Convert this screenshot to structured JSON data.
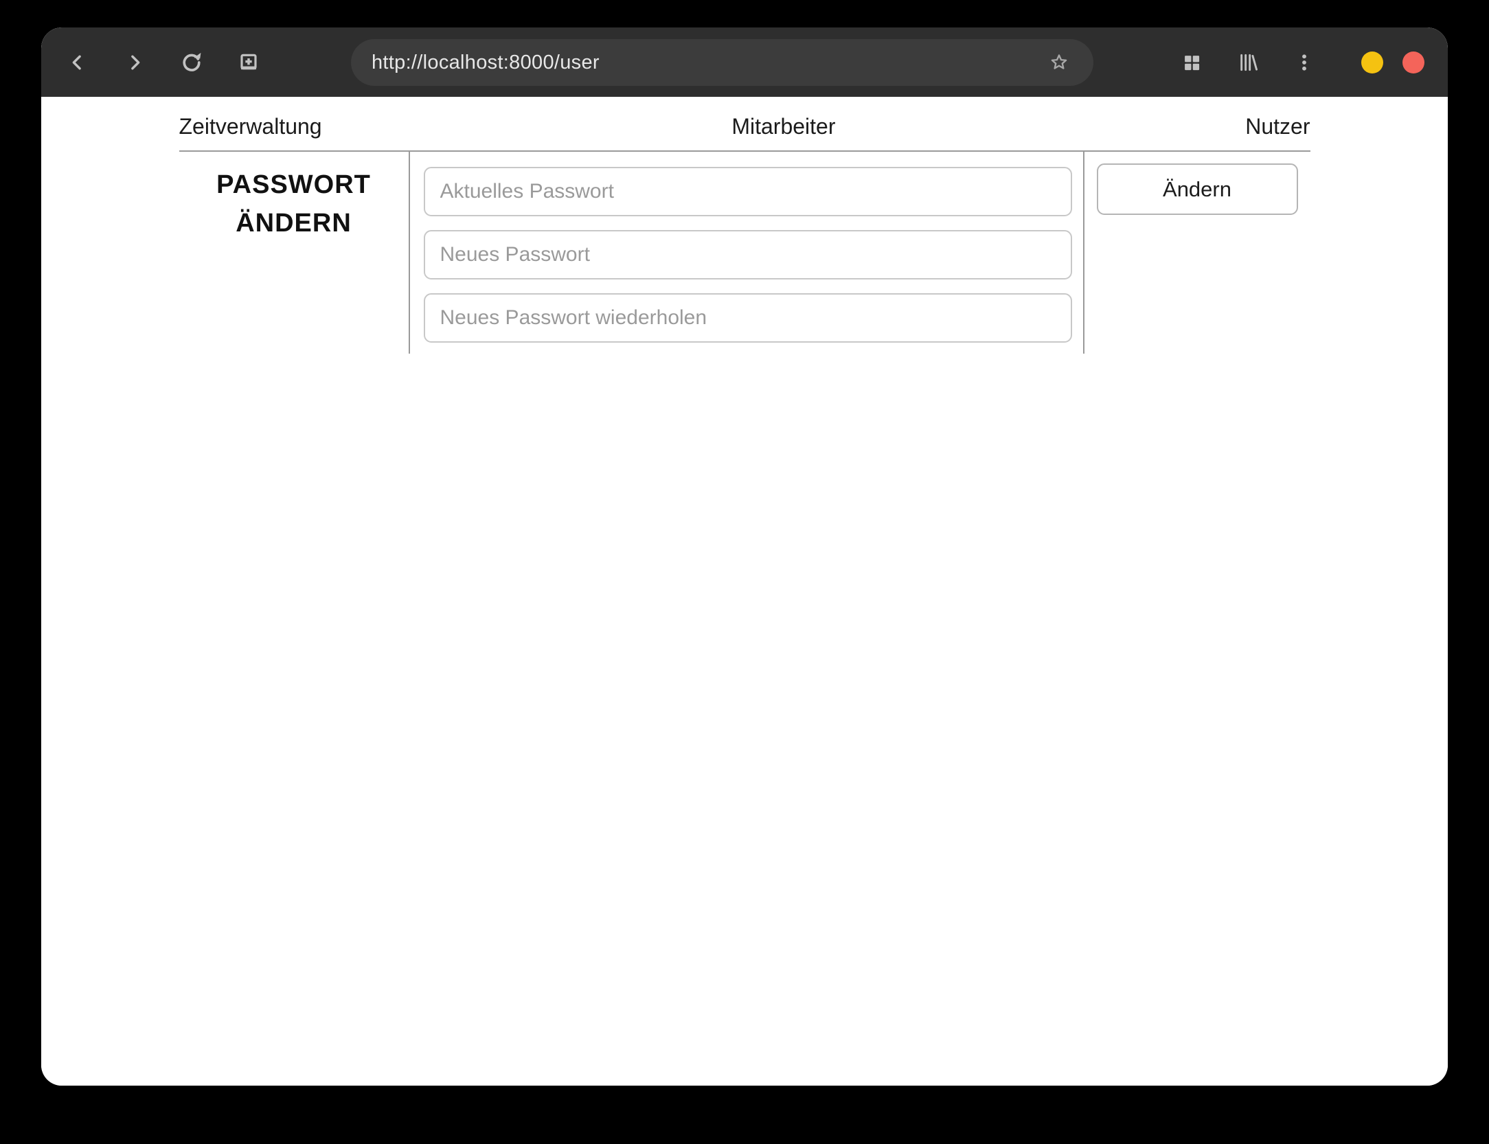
{
  "browser": {
    "url": "http://localhost:8000/user",
    "colors": {
      "desktop_bg": "#000000",
      "toolbar_bg": "#2e2e2e",
      "urlbar_bg": "#3c3c3c",
      "icon_color": "#c2c2c2",
      "minimize_button": "#f5c211",
      "close_button": "#f4645a",
      "rule_color": "#9a9a9a"
    },
    "icons": {
      "left": [
        "back-icon",
        "forward-icon",
        "reload-icon",
        "new-window-icon"
      ],
      "urlbar": [
        "bookmark-star-icon"
      ],
      "right": [
        "grid-icon",
        "library-icon",
        "kebab-menu-icon"
      ]
    }
  },
  "nav": {
    "items": [
      {
        "label": "Zeitverwaltung"
      },
      {
        "label": "Mitarbeiter"
      },
      {
        "label": "Nutzer"
      }
    ]
  },
  "password_form": {
    "heading": "PASSWORT ÄNDERN",
    "fields": [
      {
        "placeholder": "Aktuelles Passwort",
        "value": ""
      },
      {
        "placeholder": "Neues Passwort",
        "value": ""
      },
      {
        "placeholder": "Neues Passwort wiederholen",
        "value": ""
      }
    ],
    "submit_label": "Ändern"
  }
}
